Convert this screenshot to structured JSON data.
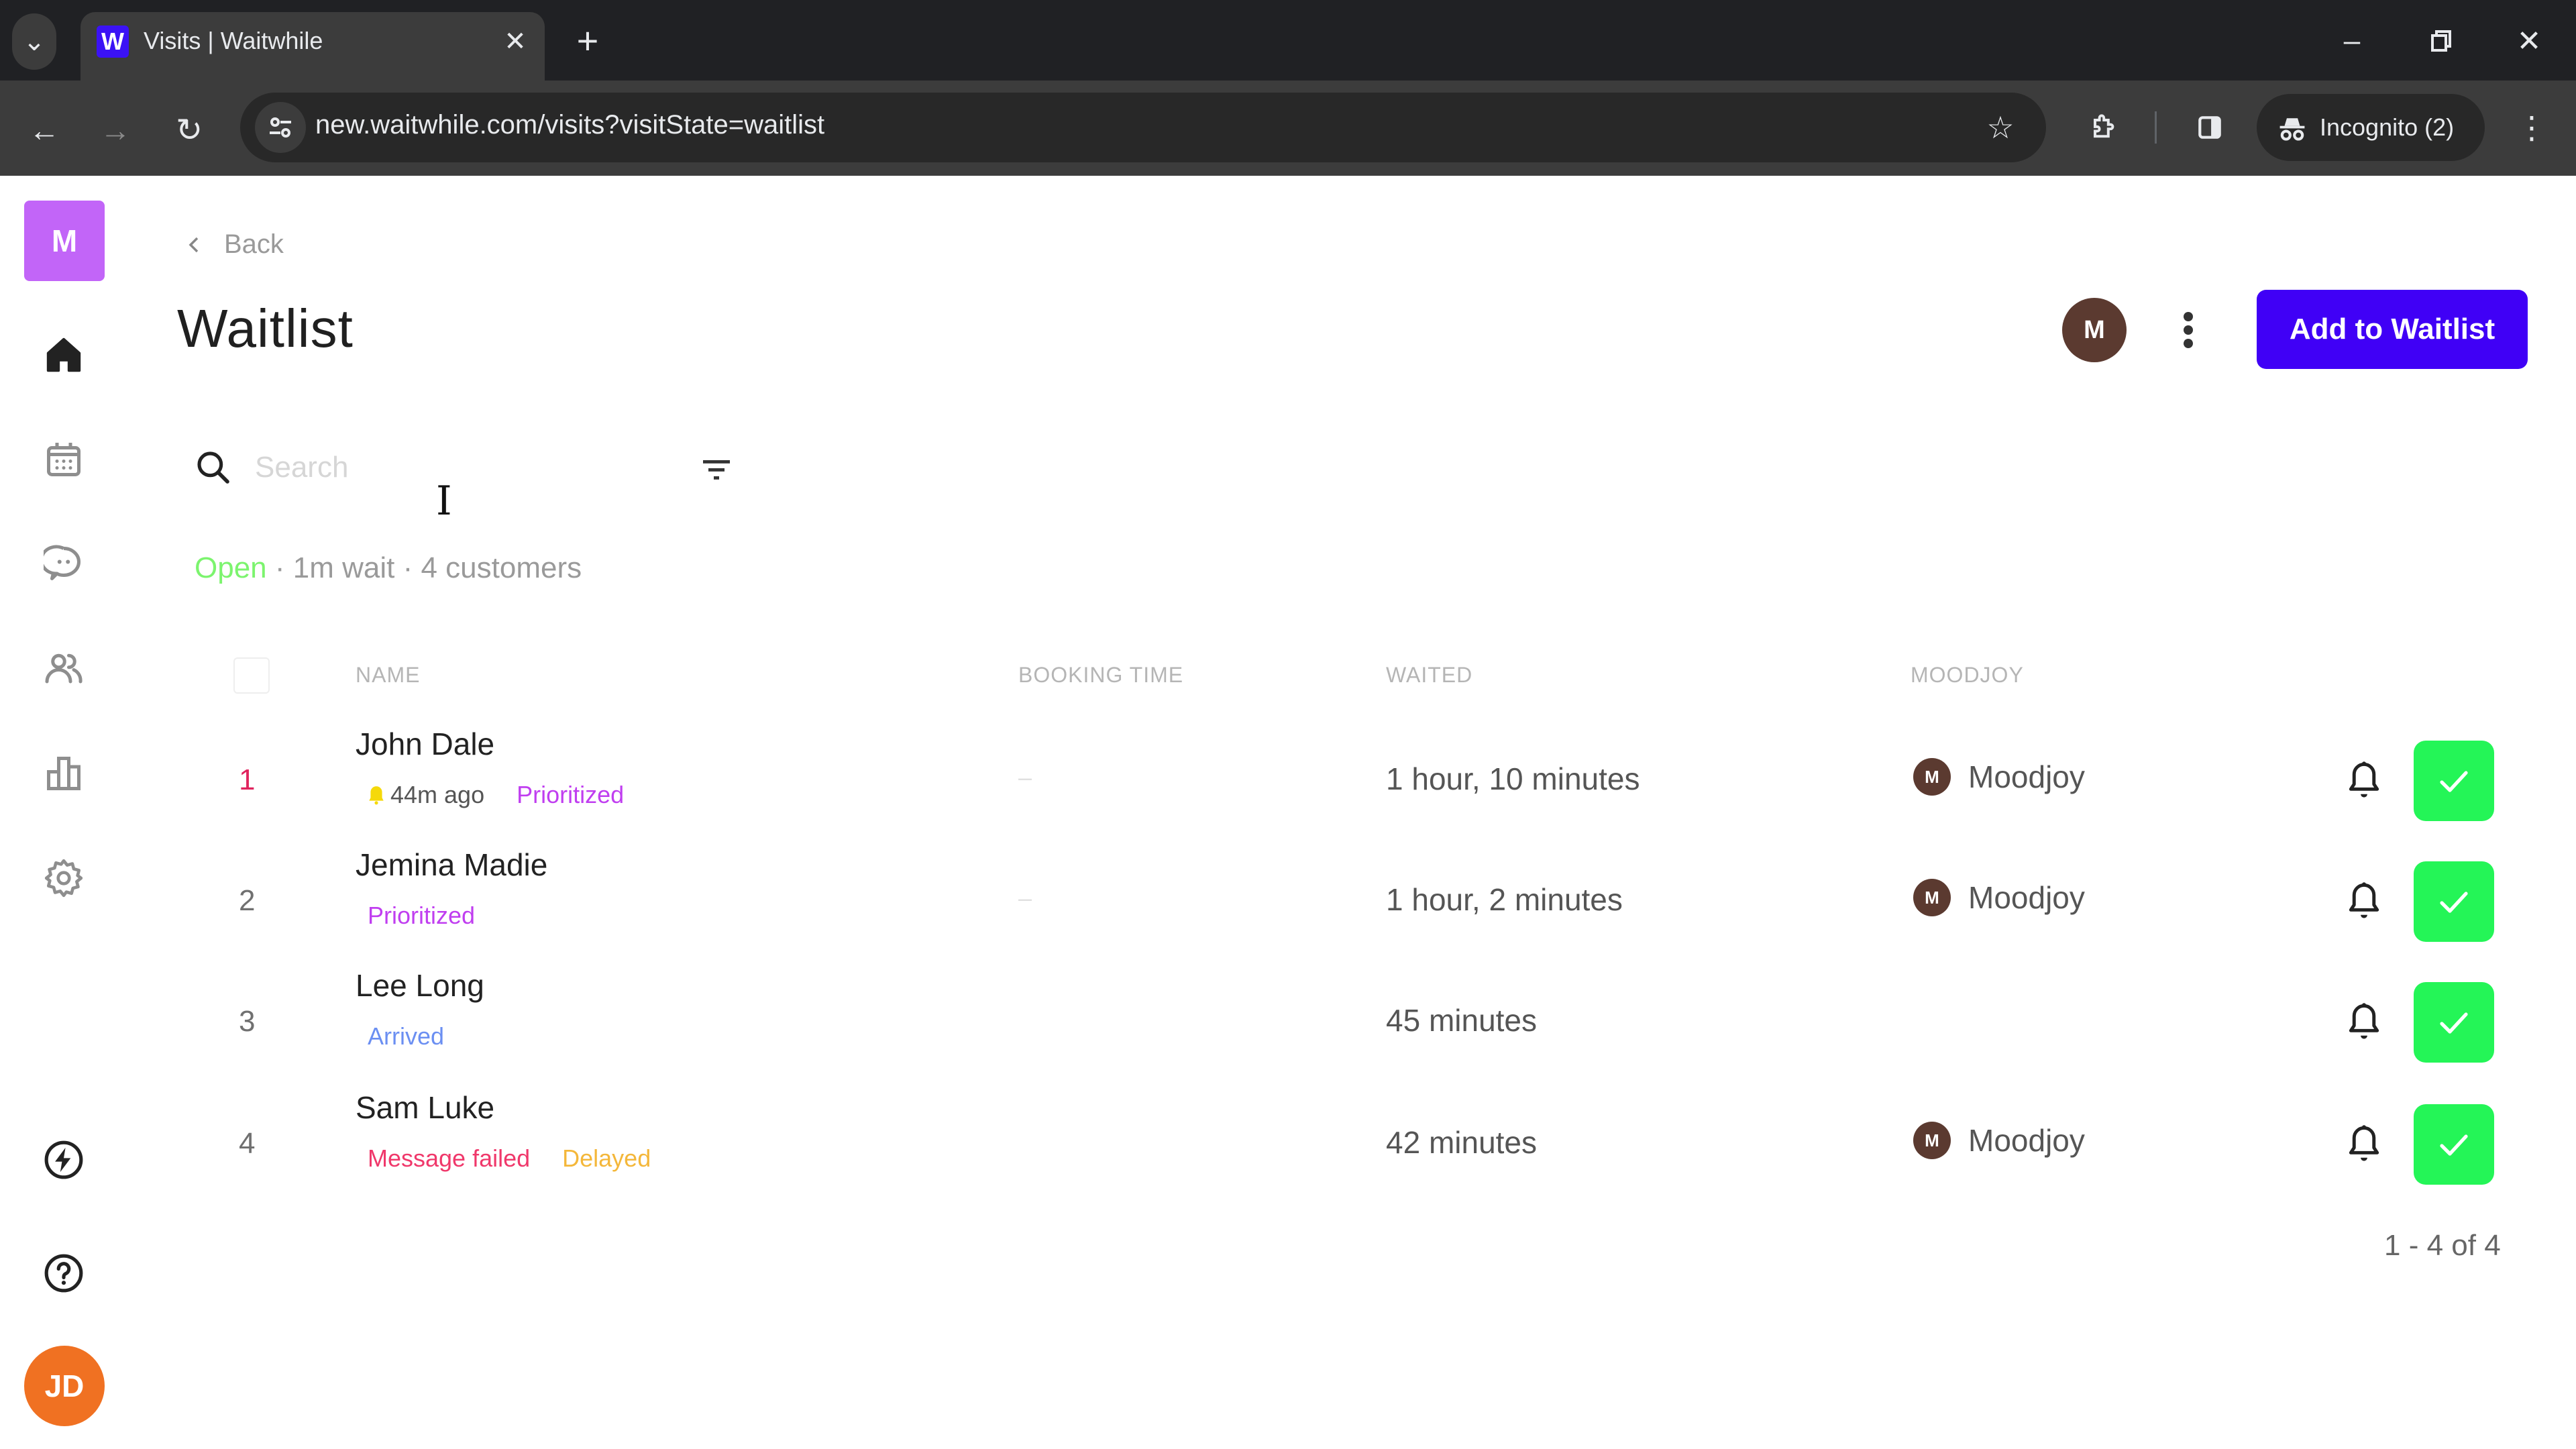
{
  "browser": {
    "tab_title": "Visits | Waitwhile",
    "favicon_letter": "W",
    "url": "new.waitwhile.com/visits?visitState=waitlist",
    "incognito_label": "Incognito (2)",
    "icons": {
      "tab_list": "chevron-down-icon",
      "tab_close": "close-icon",
      "new_tab": "plus-icon",
      "back": "arrow-left-icon",
      "forward": "arrow-right-icon",
      "reload": "reload-icon",
      "site_info": "tune-icon",
      "bookmark": "star-icon",
      "extensions": "puzzle-icon",
      "side_panel": "side-panel-icon",
      "incognito": "incognito-icon",
      "menu": "kebab-menu-icon"
    },
    "glyphs": {
      "tab_list": "⌄",
      "tab_close": "✕",
      "new_tab": "+",
      "back": "←",
      "forward": "→",
      "reload": "↻",
      "bookmark": "☆",
      "menu": "⋮",
      "minimize": "–",
      "close": "✕"
    }
  },
  "sidebar": {
    "org_initial": "M",
    "items": [
      {
        "name": "home",
        "icon": "home-icon",
        "active": true
      },
      {
        "name": "calendar",
        "icon": "calendar-icon",
        "active": false
      },
      {
        "name": "messages",
        "icon": "chat-icon",
        "active": false
      },
      {
        "name": "customers",
        "icon": "users-icon",
        "active": false
      },
      {
        "name": "analytics",
        "icon": "bar-chart-icon",
        "active": false
      },
      {
        "name": "settings",
        "icon": "gear-icon",
        "active": false
      }
    ],
    "bottom": [
      {
        "name": "whats-new",
        "icon": "lightning-icon"
      },
      {
        "name": "help",
        "icon": "help-icon"
      }
    ],
    "user_initials": "JD"
  },
  "header": {
    "back_label": "Back",
    "title": "Waitlist",
    "avatar_initial": "M",
    "add_button_label": "Add to Waitlist"
  },
  "search": {
    "placeholder": "Search",
    "value": ""
  },
  "status": {
    "state": "Open",
    "wait": "1m wait",
    "customers": "4 customers",
    "separator": " · "
  },
  "table": {
    "columns": [
      "NAME",
      "BOOKING TIME",
      "WAITED",
      "MOODJOY"
    ],
    "rows": [
      {
        "position": "1",
        "name": "John Dale",
        "notified": "44m ago",
        "tags": [
          {
            "label": "Prioritized",
            "color": "#c03ef0"
          }
        ],
        "booking_time": "–",
        "waited": "1 hour, 10 minutes",
        "assignee": "Moodjoy",
        "assignee_initial": "M"
      },
      {
        "position": "2",
        "name": "Jemina Madie",
        "notified": null,
        "tags": [
          {
            "label": "Prioritized",
            "color": "#c03ef0"
          }
        ],
        "booking_time": "–",
        "waited": "1 hour, 2 minutes",
        "assignee": "Moodjoy",
        "assignee_initial": "M"
      },
      {
        "position": "3",
        "name": "Lee Long",
        "notified": null,
        "tags": [
          {
            "label": "Arrived",
            "color": "#6b8ff2"
          }
        ],
        "booking_time": "",
        "waited": "45 minutes",
        "assignee": "",
        "assignee_initial": ""
      },
      {
        "position": "4",
        "name": "Sam Luke",
        "notified": null,
        "tags": [
          {
            "label": "Message failed",
            "color": "#f0386b"
          },
          {
            "label": "Delayed",
            "color": "#f4b73a"
          }
        ],
        "booking_time": "",
        "waited": "42 minutes",
        "assignee": "Moodjoy",
        "assignee_initial": "M"
      }
    ],
    "row_actions": {
      "notify_icon": "bell-icon",
      "serve_icon": "check-icon"
    }
  },
  "pagination": "1 - 4 of 4",
  "colors": {
    "brand": "#4000f6",
    "org_badge": "#c265f8",
    "user_avatar": "#f07122",
    "assignee_avatar": "#5b3a30",
    "serve_button": "#24f557",
    "open_status": "#7cf46e",
    "first_position": "#e0245e"
  }
}
